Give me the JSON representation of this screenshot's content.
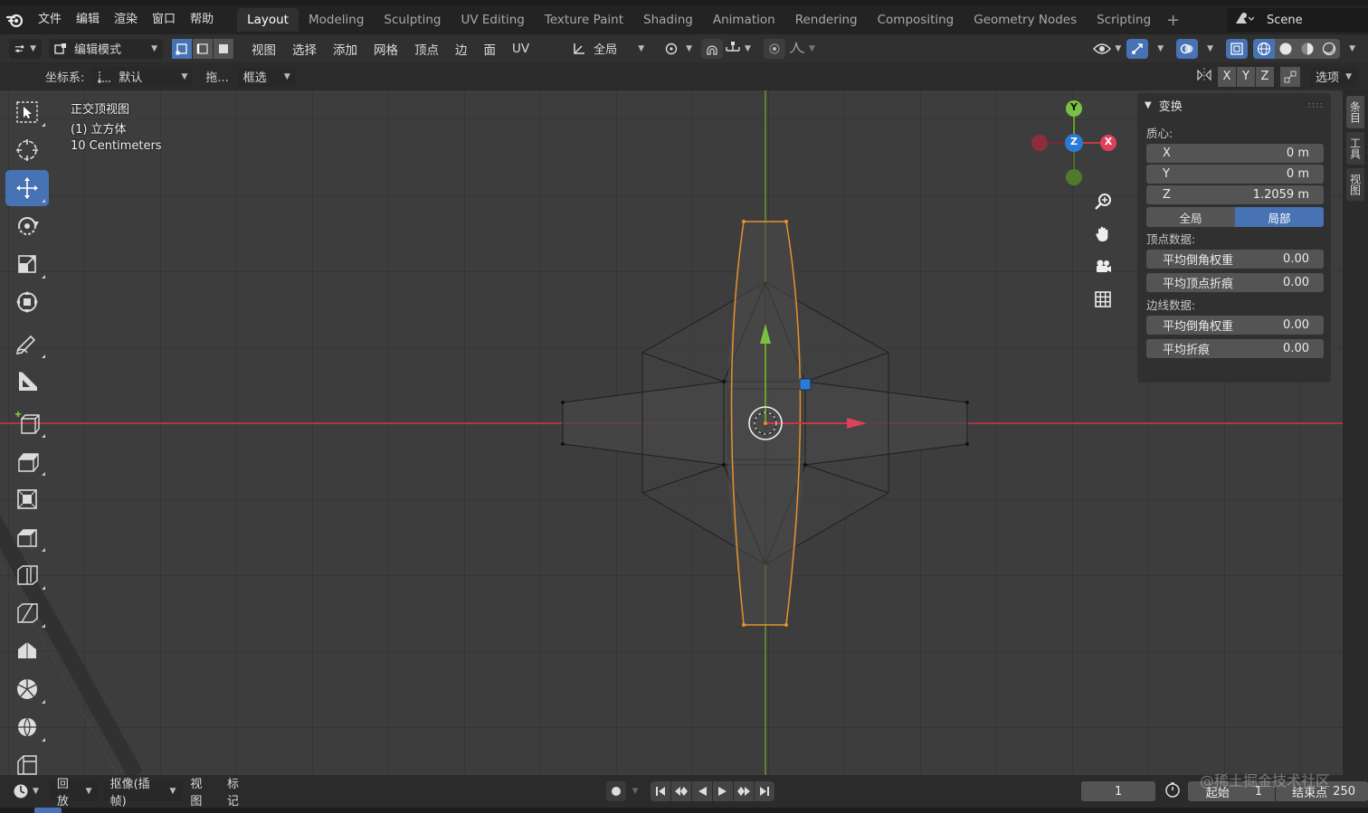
{
  "menubar": {
    "items": [
      "文件",
      "编辑",
      "渲染",
      "窗口",
      "帮助"
    ],
    "workspaces": [
      "Layout",
      "Modeling",
      "Sculpting",
      "UV Editing",
      "Texture Paint",
      "Shading",
      "Animation",
      "Rendering",
      "Compositing",
      "Geometry Nodes",
      "Scripting"
    ],
    "active_workspace": "Layout",
    "add_tab": "+",
    "scene_name": "Scene"
  },
  "header": {
    "mode": "编辑模式",
    "menus": [
      "视图",
      "选择",
      "添加",
      "网格",
      "顶点",
      "边",
      "面",
      "UV"
    ],
    "transform_orientation": "全局"
  },
  "tool_settings": {
    "coord_label": "坐标系:",
    "coord_value": "默认",
    "drag_label": "拖...",
    "select_mode": "框选",
    "axis": [
      "X",
      "Y",
      "Z"
    ],
    "options_label": "选项"
  },
  "viewport": {
    "view_name": "正交顶视图",
    "object_name": "(1) 立方体",
    "scale_text": "10 Centimeters",
    "gizmo": {
      "y": "Y",
      "z": "Z",
      "x": "X"
    }
  },
  "npanel": {
    "section_title": "变换",
    "centroid_label": "质心:",
    "centroid": [
      {
        "axis": "X",
        "value": "0 m"
      },
      {
        "axis": "Y",
        "value": "0 m"
      },
      {
        "axis": "Z",
        "value": "1.2059 m"
      }
    ],
    "toggle": {
      "global": "全局",
      "local": "局部",
      "active": "local"
    },
    "vertex_data_label": "顶点数据:",
    "vertex_data": [
      {
        "label": "平均倒角权重",
        "value": "0.00"
      },
      {
        "label": "平均顶点折痕",
        "value": "0.00"
      }
    ],
    "edge_data_label": "边线数据:",
    "edge_data": [
      {
        "label": "平均倒角权重",
        "value": "0.00"
      },
      {
        "label": "平均折痕",
        "value": "0.00"
      }
    ]
  },
  "side_tabs": [
    "条目",
    "工具",
    "视图"
  ],
  "timeline": {
    "playback": "回放",
    "keying": "抠像(插帧)",
    "view": "视图",
    "marker": "标记",
    "current_frame": "1",
    "start_label": "起始",
    "start_value": "1",
    "end_label": "结束点",
    "end_value": "250"
  },
  "watermark": "@稀土掘金技术社区",
  "colors": {
    "accent": "#4772b3",
    "x_axis": "#c9374b",
    "y_axis": "#6aa02b",
    "z_axis": "#2a7bd6",
    "selection": "#e8912b"
  }
}
